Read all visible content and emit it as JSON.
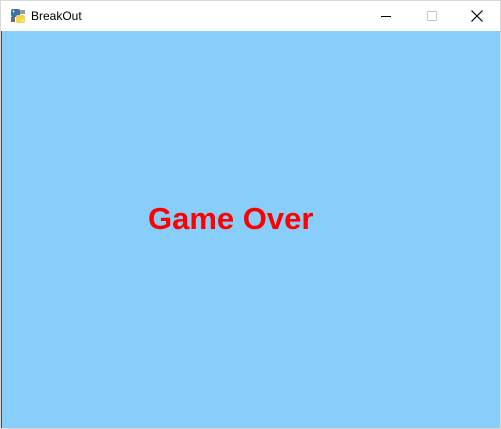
{
  "window": {
    "title": "BreakOut",
    "app_icon": "python-icon",
    "controls": {
      "minimize_icon": "minimize-icon",
      "maximize_icon": "maximize-icon",
      "close_icon": "close-icon"
    }
  },
  "game": {
    "background_color": "#87cefa",
    "message": "Game Over",
    "message_color": "#ff0000"
  }
}
